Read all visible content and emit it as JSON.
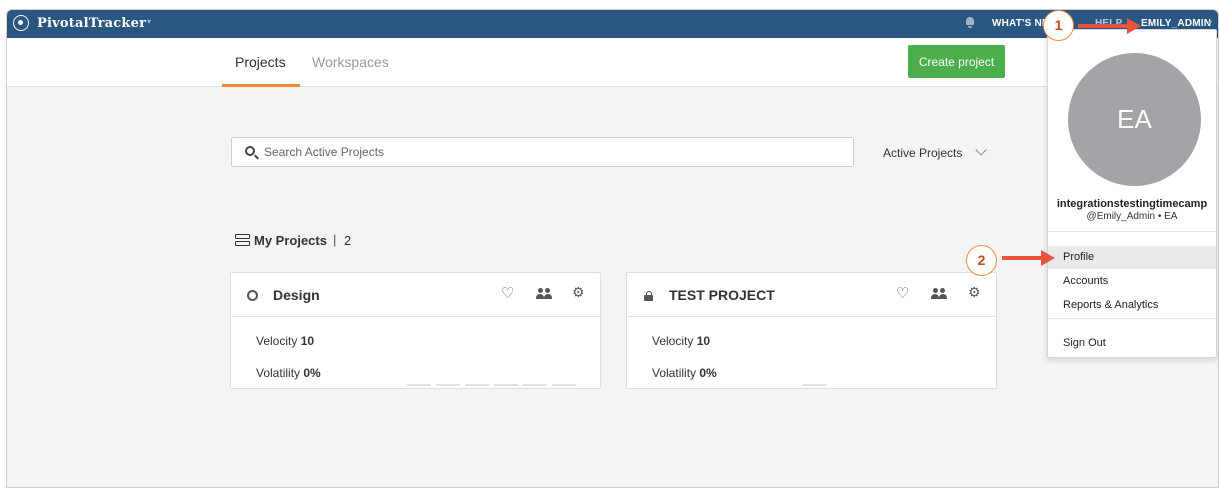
{
  "topbar": {
    "brand": "PivotalTracker",
    "caret": "▾",
    "whats_new": "WHAT'S NEW",
    "help": "HELP",
    "user": "EMILY_ADMIN",
    "user_caret": "▾",
    "color": "#2a5781"
  },
  "tabs": [
    {
      "label": "Projects",
      "active": true
    },
    {
      "label": "Workspaces",
      "active": false
    }
  ],
  "tab_accent_color": "#f0873c",
  "create_button": {
    "label": "Create project",
    "color": "#4cae4c"
  },
  "search": {
    "placeholder": "Search Active Projects",
    "value": ""
  },
  "filter": {
    "selected": "Active Projects"
  },
  "section": {
    "title": "My Projects",
    "separator": "|",
    "count": "2"
  },
  "projects": [
    {
      "name": "Design",
      "visibility_icon": "globe-icon",
      "velocity_label": "Velocity",
      "velocity": "10",
      "volatility_label": "Volatility",
      "volatility": "0%"
    },
    {
      "name": "TEST PROJECT",
      "visibility_icon": "lock-icon",
      "velocity_label": "Velocity",
      "velocity": "10",
      "volatility_label": "Volatility",
      "volatility": "0%"
    }
  ],
  "user_menu": {
    "initials": "EA",
    "name": "integrationstestingtimecamp",
    "handle": "@Emily_Admin  •  EA",
    "items": [
      "Profile",
      "Accounts",
      "Reports & Analytics",
      "Sign Out"
    ],
    "highlighted": "Profile"
  },
  "callouts": [
    "1",
    "2"
  ],
  "callout_color": "#e8533b"
}
